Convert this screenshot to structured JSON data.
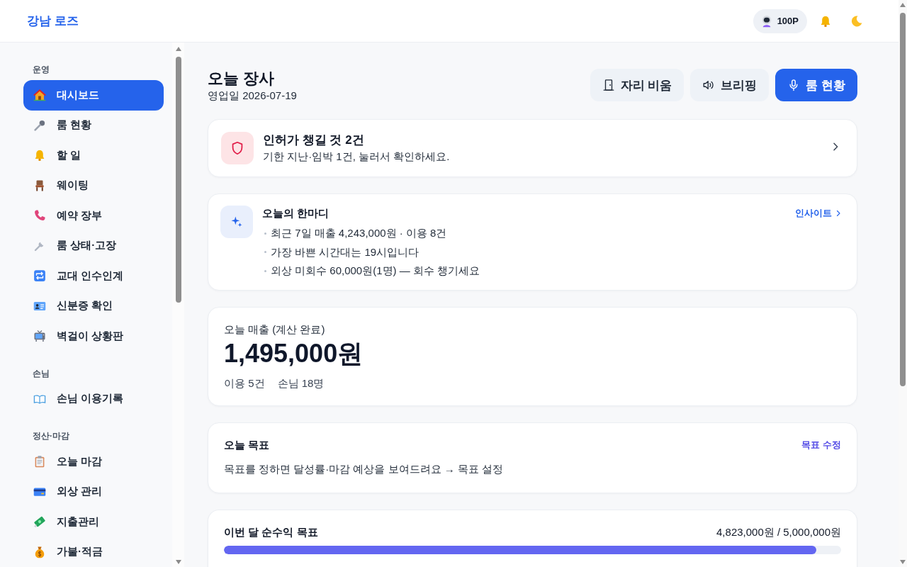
{
  "header": {
    "logo": "강남 로즈",
    "points": "100P"
  },
  "sidebar": {
    "sections": [
      {
        "title": "운영",
        "items": [
          {
            "label": "대시보드",
            "selected": true
          },
          {
            "label": "룸 현황",
            "selected": false
          },
          {
            "label": "할 일",
            "selected": false
          },
          {
            "label": "웨이팅",
            "selected": false
          },
          {
            "label": "예약 장부",
            "selected": false
          },
          {
            "label": "룸 상태·고장",
            "selected": false
          },
          {
            "label": "교대 인수인계",
            "selected": false
          },
          {
            "label": "신분증 확인",
            "selected": false
          },
          {
            "label": "벽걸이 상황판",
            "selected": false
          }
        ]
      },
      {
        "title": "손님",
        "items": [
          {
            "label": "손님 이용기록",
            "selected": false
          }
        ]
      },
      {
        "title": "정산·마감",
        "items": [
          {
            "label": "오늘 마감",
            "selected": false
          },
          {
            "label": "외상 관리",
            "selected": false
          },
          {
            "label": "지출관리",
            "selected": false
          },
          {
            "label": "가불·적금",
            "selected": false
          }
        ]
      }
    ]
  },
  "page": {
    "title": "오늘 장사",
    "subtitle": "영업일 2026-07-19",
    "actions": [
      {
        "label": "자리 비움",
        "kind": "secondary"
      },
      {
        "label": "브리핑",
        "kind": "secondary"
      },
      {
        "label": "룸 현황",
        "kind": "primary"
      }
    ]
  },
  "alert": {
    "title": "인허가 챙길 것 2건",
    "message": "기한 지난·임박 1건, 눌러서 확인하세요."
  },
  "insight": {
    "title": "오늘의 한마디",
    "link": "인사이트",
    "bullets": [
      "최근 7일 매출 4,243,000원 · 이용 8건",
      "가장 바쁜 시간대는 19시입니다",
      "외상 미회수 60,000원(1명) — 회수 챙기세요"
    ]
  },
  "sales": {
    "label": "오늘 매출 (계산 완료)",
    "amount": "1,495,000원",
    "stats": [
      "이용 5건",
      "손님 18명"
    ]
  },
  "goal": {
    "title": "오늘 목표",
    "link": "목표 수정",
    "message": "목표를 정하면 달성률·마감 예상을 보여드려요 → 목표 설정"
  },
  "monthly_goal": {
    "title": "이번 달 순수익 목표",
    "amount": "4,823,000원 / 5,000,000원",
    "level": 0.96
  }
}
